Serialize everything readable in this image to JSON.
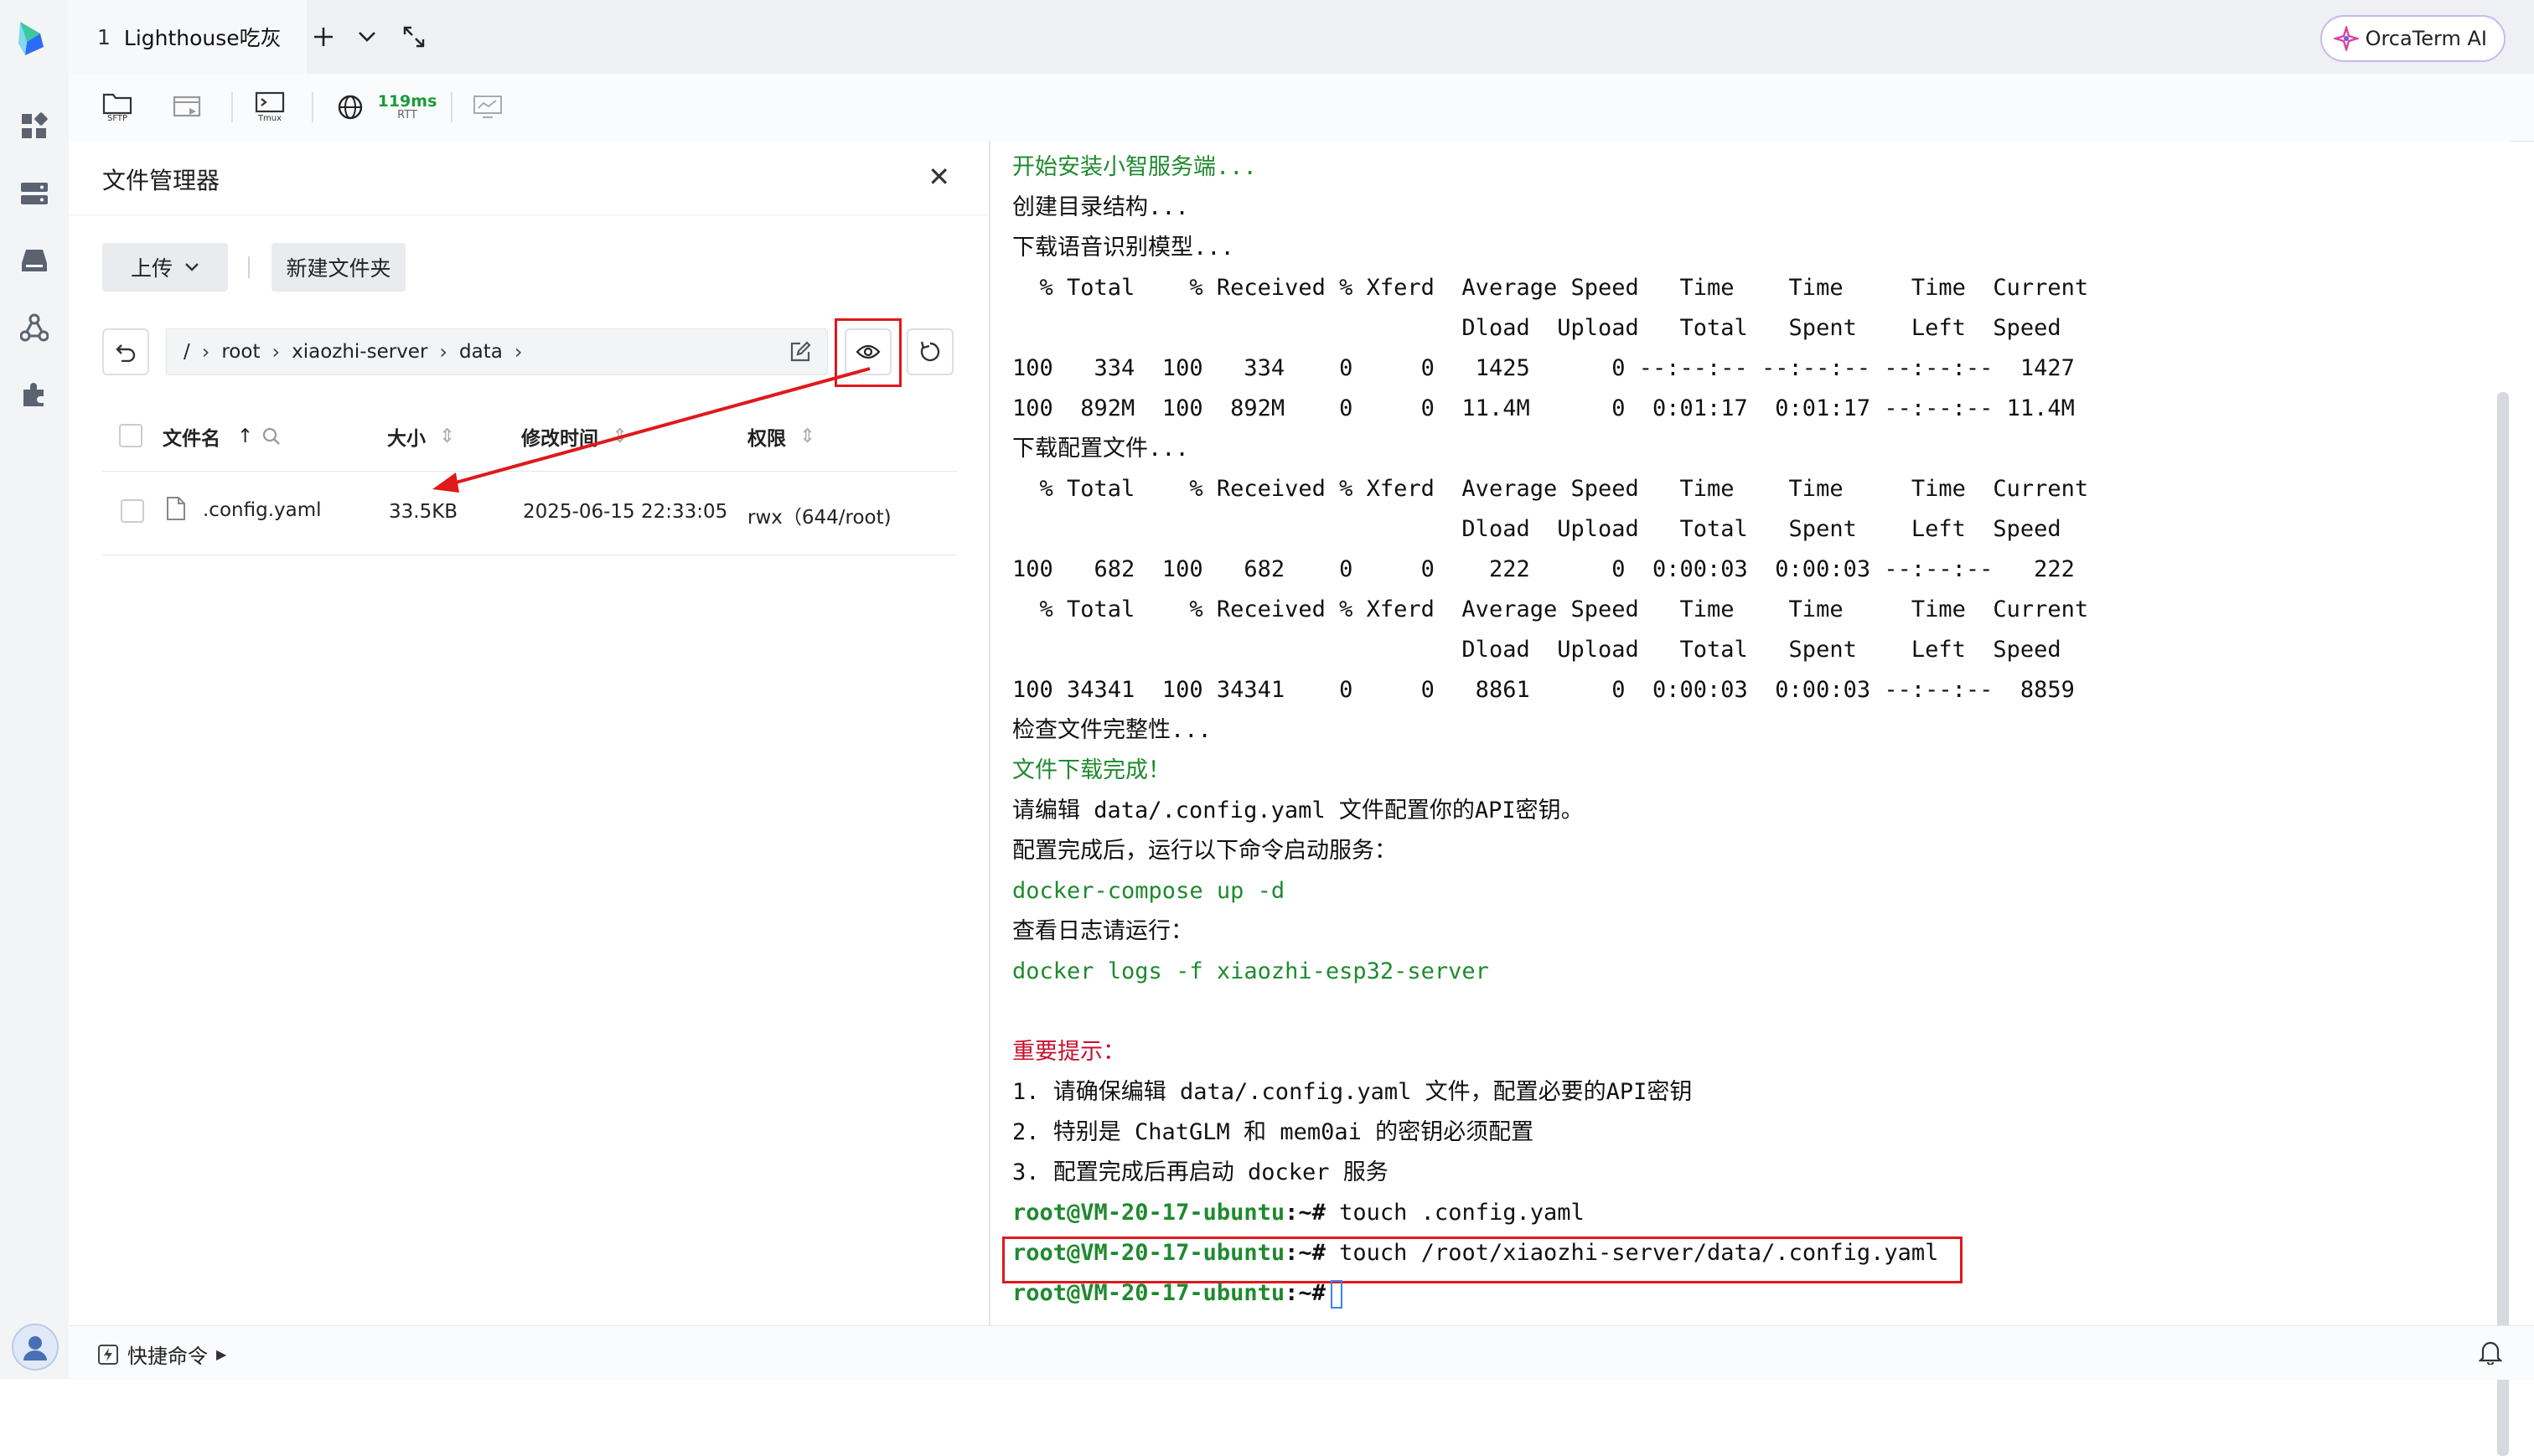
{
  "tab": {
    "index": "1",
    "title": "Lighthouse吃灰"
  },
  "ai_button": {
    "label": "OrcaTerm AI"
  },
  "toolbar": {
    "sftp_label": "SFTP",
    "tmux_label": "Tmux",
    "rtt_value": "119ms",
    "rtt_label": "RTT"
  },
  "file_manager": {
    "title": "文件管理器",
    "upload_label": "上传",
    "new_folder_label": "新建文件夹",
    "breadcrumb": [
      "/",
      "root",
      "xiaozhi-server",
      "data"
    ],
    "columns": {
      "name": "文件名",
      "size": "大小",
      "modified": "修改时间",
      "permission": "权限"
    },
    "files": [
      {
        "name": ".config.yaml",
        "size": "33.5KB",
        "modified": "2025-06-15 22:33:05",
        "permission": "rwx（644/root)"
      }
    ]
  },
  "terminal": {
    "prompt": "root@VM-20-17-ubuntu",
    "prompt_suffix": ":~#",
    "lines": [
      "开始安装小智服务端...",
      "创建目录结构...",
      "下载语音识别模型...",
      "  % Total    % Received % Xferd  Average Speed   Time    Time     Time  Current",
      "                                 Dload  Upload   Total   Spent    Left  Speed",
      "100   334  100   334    0     0   1425      0 --:--:-- --:--:-- --:--:--  1427",
      "100  892M  100  892M    0     0  11.4M      0  0:01:17  0:01:17 --:--:-- 11.4M",
      "下载配置文件...",
      "  % Total    % Received % Xferd  Average Speed   Time    Time     Time  Current",
      "                                 Dload  Upload   Total   Spent    Left  Speed",
      "100   682  100   682    0     0    222      0  0:00:03  0:00:03 --:--:--   222",
      "  % Total    % Received % Xferd  Average Speed   Time    Time     Time  Current",
      "                                 Dload  Upload   Total   Spent    Left  Speed",
      "100 34341  100 34341    0     0   8861      0  0:00:03  0:00:03 --:--:--  8859",
      "检查文件完整性...",
      "文件下载完成！",
      "请编辑 data/.config.yaml 文件配置你的API密钥。",
      "配置完成后，运行以下命令启动服务：",
      "docker-compose up -d",
      "查看日志请运行：",
      "docker logs -f xiaozhi-esp32-server",
      "",
      "重要提示：",
      "1. 请确保编辑 data/.config.yaml 文件，配置必要的API密钥",
      "2. 特别是 ChatGLM 和 mem0ai 的密钥必须配置",
      "3. 配置完成后再启动 docker 服务"
    ],
    "cmd1": " touch .config.yaml",
    "cmd2": " touch /root/xiaozhi-server/data/.config.yaml"
  },
  "status_bar": {
    "quick_cmd_label": "快捷命令"
  },
  "colors": {
    "green_text": "#1f8a2f",
    "red_text": "#c8102e",
    "annotation_red": "#e0191b",
    "rtt_green": "#1a9b3a"
  }
}
